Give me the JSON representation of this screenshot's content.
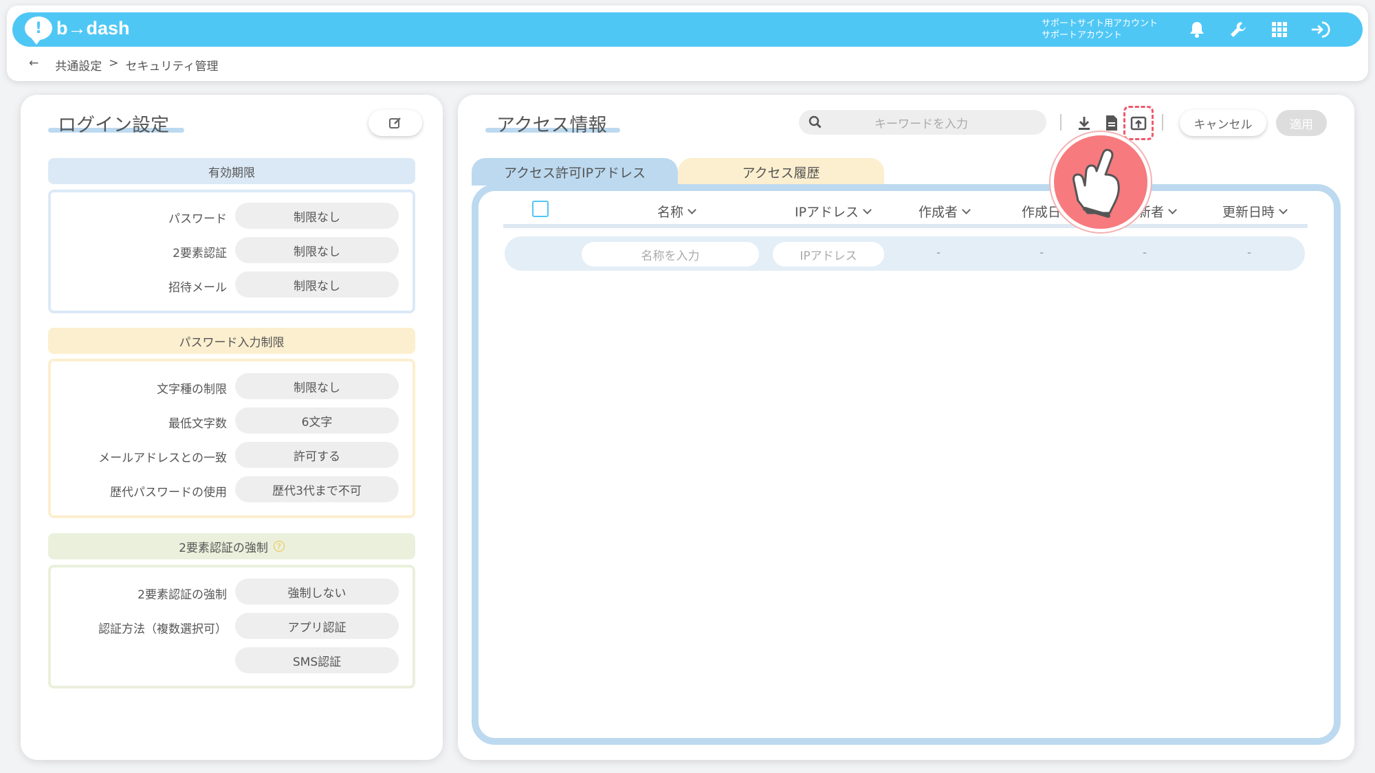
{
  "header": {
    "logo_text": "b→dash",
    "account_line1": "サポートサイト用アカウント",
    "account_line2": "サポートアカウント",
    "icons": [
      "bell-icon",
      "wrench-icon",
      "grid-icon",
      "logout-icon"
    ]
  },
  "breadcrumb": {
    "back": "←",
    "item1": "共通設定",
    "sep": ">",
    "item2": "セキュリティ管理"
  },
  "login_settings": {
    "title": "ログイン設定",
    "sections": [
      {
        "title": "有効期限",
        "rows": [
          {
            "label": "パスワード",
            "value": "制限なし"
          },
          {
            "label": "2要素認証",
            "value": "制限なし"
          },
          {
            "label": "招待メール",
            "value": "制限なし"
          }
        ]
      },
      {
        "title": "パスワード入力制限",
        "rows": [
          {
            "label": "文字種の制限",
            "value": "制限なし"
          },
          {
            "label": "最低文字数",
            "value": "6文字"
          },
          {
            "label": "メールアドレスとの一致",
            "value": "許可する"
          },
          {
            "label": "歴代パスワードの使用",
            "value": "歴代3代まで不可"
          }
        ]
      },
      {
        "title": "2要素認証の強制",
        "rows": [
          {
            "label": "2要素認証の強制",
            "value": "強制しない"
          },
          {
            "label": "認証方法（複数選択可）",
            "value": "アプリ認証"
          },
          {
            "label": "",
            "value": "SMS認証"
          }
        ]
      }
    ]
  },
  "access_info": {
    "title": "アクセス情報",
    "search_placeholder": "キーワードを入力",
    "cancel_label": "キャンセル",
    "apply_label": "適用",
    "tabs": [
      "アクセス許可IPアドレス",
      "アクセス履歴"
    ],
    "columns": [
      "名称",
      "IPアドレス",
      "作成者",
      "作成日",
      "更新者",
      "更新日時"
    ],
    "filter": {
      "name_placeholder": "名称を入力",
      "ip_placeholder": "IPアドレス",
      "dash": "-"
    }
  },
  "colors": {
    "header": "#4fc7f5",
    "section_blue": "#dbe9f6",
    "section_yellow": "#fcefcf",
    "section_green": "#eaf0dc",
    "highlight": "#f0576a"
  }
}
